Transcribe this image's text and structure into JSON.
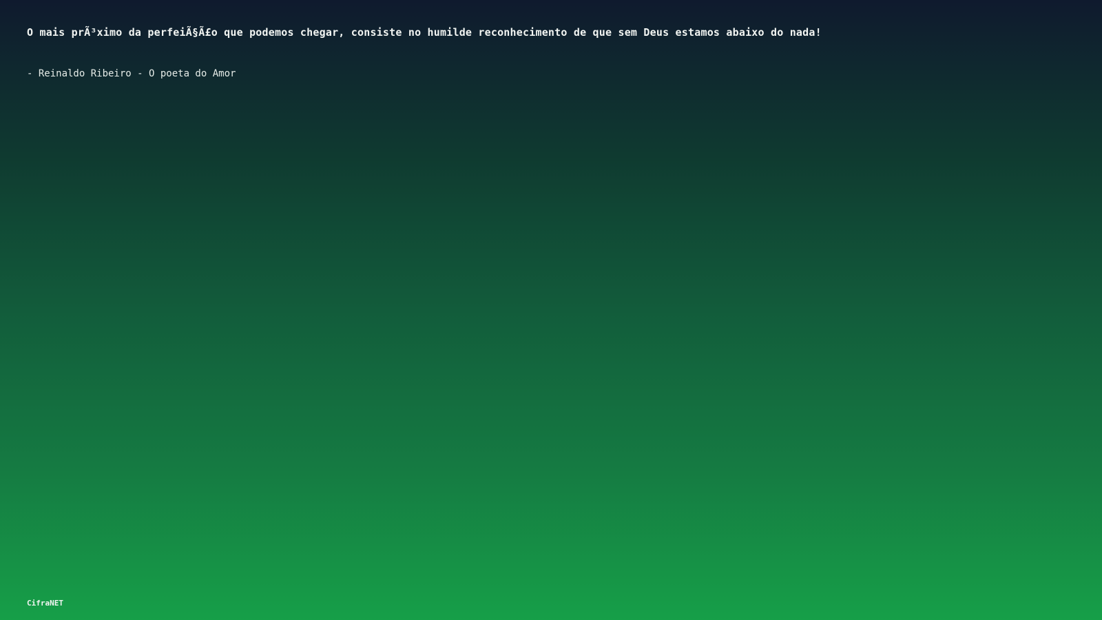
{
  "quote": {
    "text": "O mais prÃ³ximo da perfeiÃ§Ã£o que podemos chegar, consiste no humilde reconhecimento de que sem Deus estamos abaixo do nada!"
  },
  "author": {
    "text": "- Reinaldo Ribeiro - O poeta do Amor"
  },
  "brand": {
    "label": "CifraNET"
  },
  "colors": {
    "gradient_top": "#0f1a2e",
    "gradient_bottom": "#169f48",
    "text": "#f2f5f2"
  }
}
